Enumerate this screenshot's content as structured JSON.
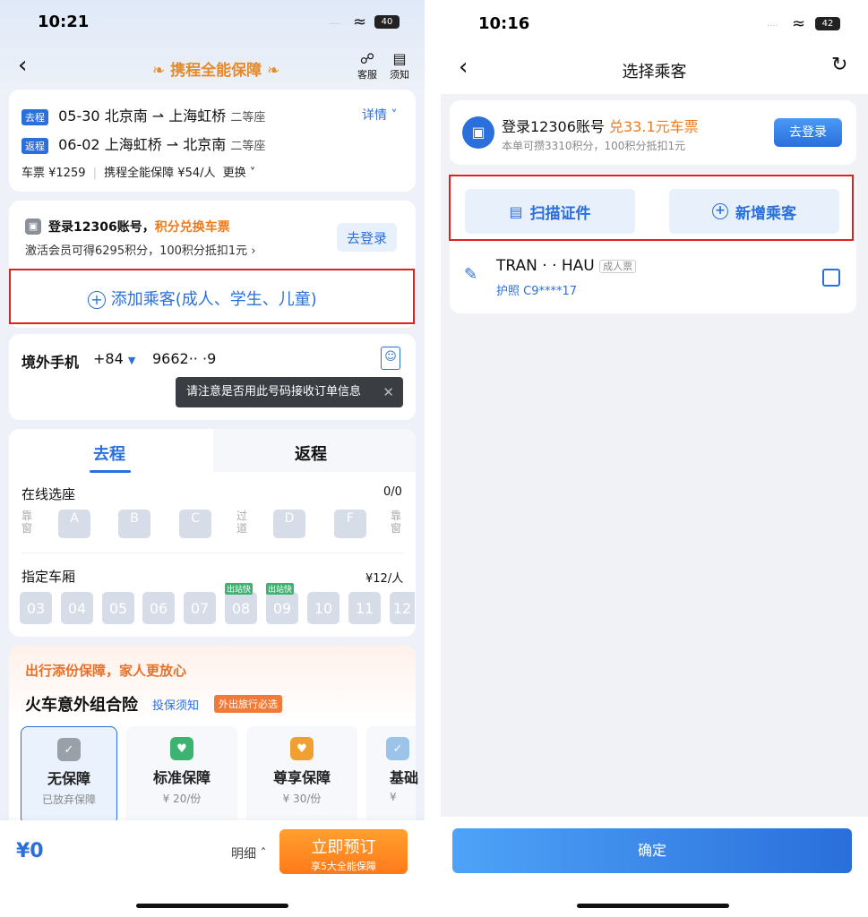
{
  "left": {
    "status": {
      "time": "10:21",
      "battery": "40"
    },
    "header": {
      "title": "携程全能保障",
      "service_label": "客服",
      "notice_label": "须知"
    },
    "trip": {
      "outbound": {
        "tag": "去程",
        "date": "05-30",
        "from": "北京南",
        "to": "上海虹桥",
        "seat": "二等座"
      },
      "return": {
        "tag": "返程",
        "date": "06-02",
        "from": "上海虹桥",
        "to": "北京南",
        "seat": "二等座"
      },
      "details_label": "详情",
      "price_line": "车票 ¥1259",
      "protect_line": "携程全能保障 ¥54/人",
      "change_label": "更换"
    },
    "login_12306": {
      "title": "登录12306账号，",
      "highlight": "积分兑换车票",
      "sub": "激活会员可得6295积分，100积分抵扣1元",
      "button": "去登录"
    },
    "add_passenger": "添加乘客(成人、学生、儿童)",
    "phone": {
      "label": "境外手机",
      "code": "+84",
      "number": "9662·· ·9",
      "tooltip": "请注意是否用此号码接收订单信息"
    },
    "tabs": {
      "outbound": "去程",
      "return": "返程"
    },
    "seat_select": {
      "title": "在线选座",
      "count": "0/0",
      "window_left": "靠窗",
      "aisle": "过道",
      "window_right": "靠窗",
      "seats": [
        "A",
        "B",
        "C",
        "D",
        "F"
      ]
    },
    "car_select": {
      "title": "指定车厢",
      "price": "¥12/人",
      "cars": [
        "03",
        "04",
        "05",
        "06",
        "07",
        "08",
        "09",
        "10",
        "11",
        "12"
      ],
      "fast_exit_label": "出站快"
    },
    "insurance": {
      "slogan": "出行添份保障，家人更放心",
      "title": "火车意外组合险",
      "notice": "投保须知",
      "badge": "外出旅行必选",
      "options": [
        {
          "name": "无保障",
          "sub": "已放弃保障"
        },
        {
          "name": "标准保障",
          "sub": "¥ 20/份"
        },
        {
          "name": "尊享保障",
          "sub": "¥ 30/份"
        },
        {
          "name": "基础",
          "sub": "¥"
        }
      ]
    },
    "footer": {
      "price": "¥0",
      "detail": "明细",
      "book": "立即预订",
      "book_sub": "享5大全能保障"
    }
  },
  "right": {
    "status": {
      "time": "10:16",
      "battery": "42"
    },
    "header": {
      "title": "选择乘客"
    },
    "login_banner": {
      "title": "登录12306账号",
      "highlight": "兑33.1元车票",
      "sub": "本单可攒3310积分，100积分抵扣1元",
      "button": "去登录"
    },
    "scan_button": "扫描证件",
    "add_button": "新增乘客",
    "passenger": {
      "name": "TRAN ·  · HAU",
      "type": "成人票",
      "doc": "护照 C9****17"
    },
    "confirm": "确定"
  },
  "colors": {
    "accent": "#2a6fdb",
    "orange": "#f07a1a",
    "red_box": "#e02020"
  }
}
